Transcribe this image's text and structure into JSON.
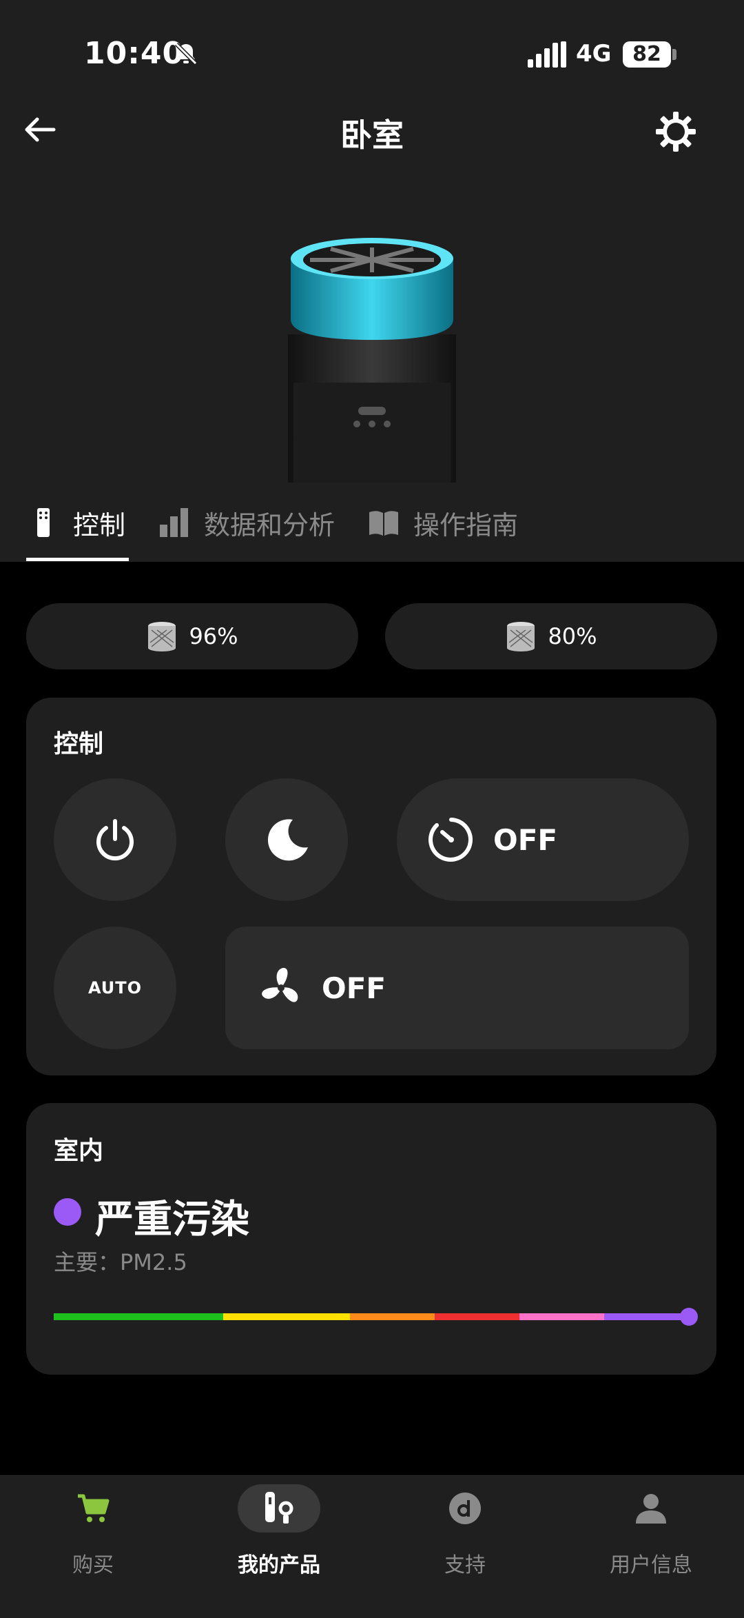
{
  "status_bar": {
    "time": "10:40",
    "network": "4G",
    "battery": "82"
  },
  "header": {
    "title": "卧室"
  },
  "tabs": [
    {
      "label": "控制",
      "icon": "remote-icon",
      "active": true
    },
    {
      "label": "数据和分析",
      "icon": "bar-chart-icon",
      "active": false
    },
    {
      "label": "操作指南",
      "icon": "book-icon",
      "active": false
    }
  ],
  "filters": [
    {
      "value": "96%",
      "icon": "filter-icon"
    },
    {
      "value": "80%",
      "icon": "filter-icon"
    }
  ],
  "controls": {
    "title": "控制",
    "timer_label": "OFF",
    "auto_label": "AUTO",
    "fan_speed_label": "OFF"
  },
  "indoor": {
    "title": "室内",
    "status": "严重污染",
    "status_color": "#9b59f5",
    "primary": "主要：PM2.5",
    "scale_colors": [
      "#1ec01e",
      "#ffe000",
      "#ff8c1a",
      "#ee3030",
      "#ff72c8",
      "#9b59f5"
    ],
    "level": 1.0
  },
  "bottom_nav": [
    {
      "label": "购买",
      "icon": "cart-icon",
      "active": false
    },
    {
      "label": "我的产品",
      "icon": "my-products-icon",
      "active": true
    },
    {
      "label": "支持",
      "icon": "support-icon",
      "active": false
    },
    {
      "label": "用户信息",
      "icon": "user-icon",
      "active": false
    }
  ]
}
